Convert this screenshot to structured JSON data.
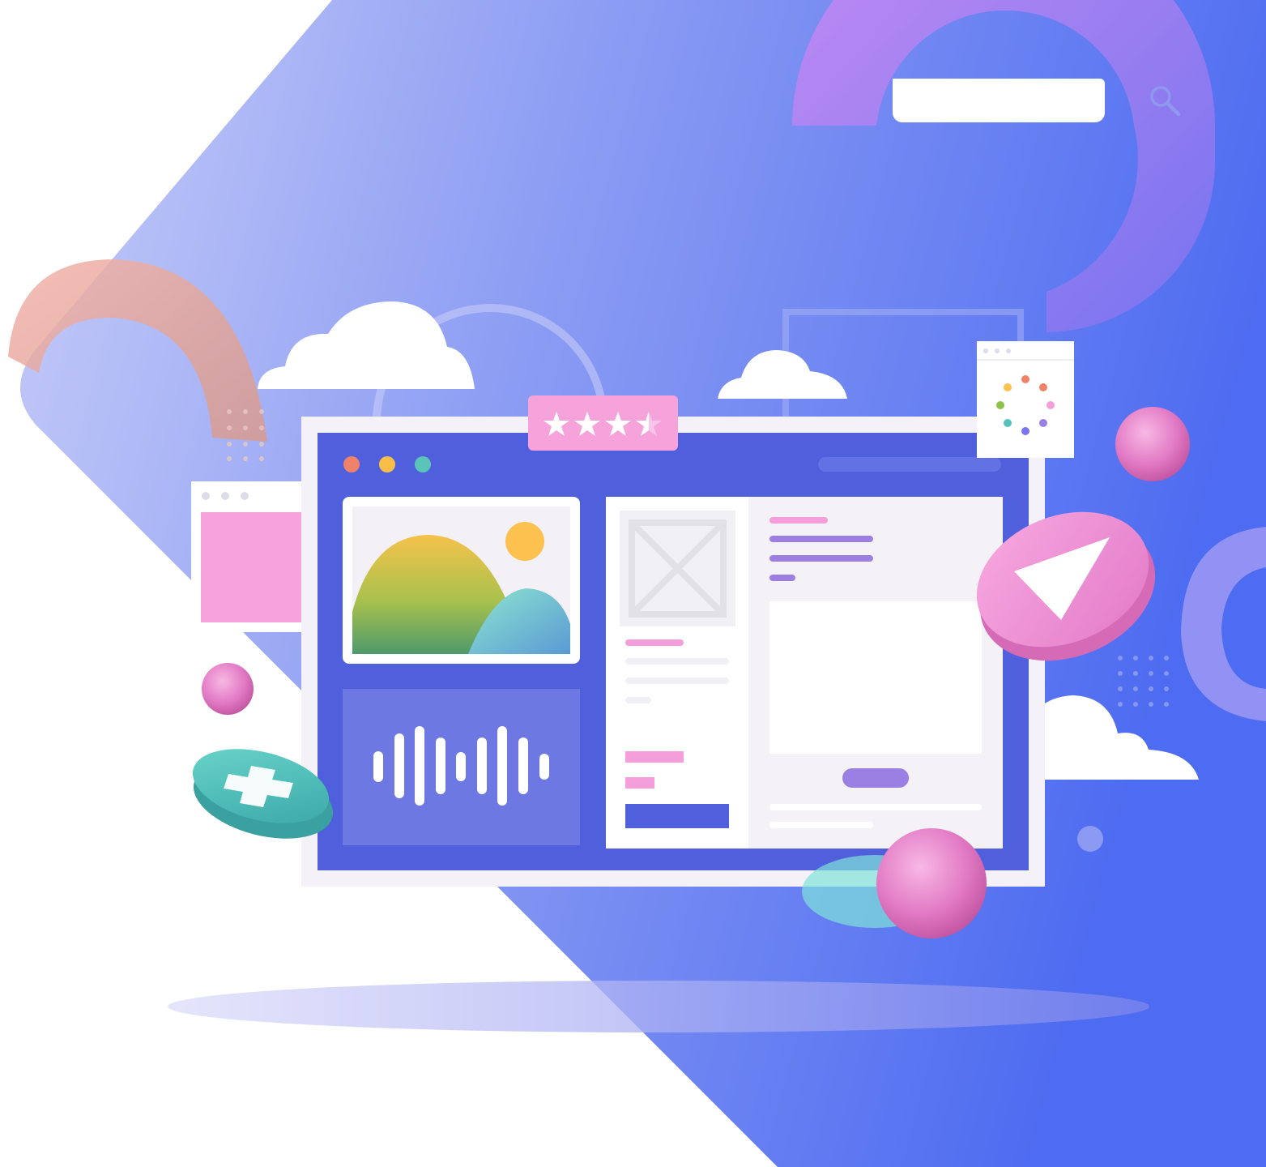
{
  "search": {
    "value": "",
    "placeholder": "",
    "icon": "search-icon"
  },
  "illustration": {
    "subject": "web-application-ui-collage",
    "rating_stars": 3.5,
    "rating_max": 5,
    "icons": [
      "image-icon",
      "audio-waveform-icon",
      "play-icon",
      "plus-icon",
      "loading-spinner-icon",
      "cloud-icon",
      "star-icon"
    ],
    "colors": {
      "background_gradient_start": "#c4c9f7",
      "background_gradient_end": "#4f6cf0",
      "window_frame": "#f4f2f7",
      "window_body": "#5363dd",
      "accent_pink": "#f49fdc",
      "accent_teal": "#56c2bd",
      "accent_purple": "#9c7fe3",
      "sun": "#fcc14f"
    }
  }
}
